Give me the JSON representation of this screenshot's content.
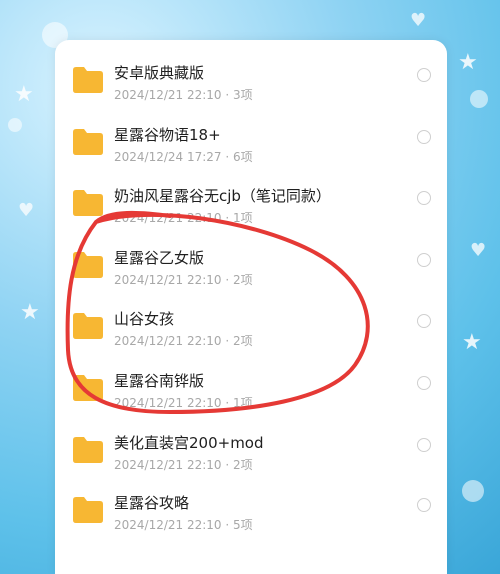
{
  "files": [
    {
      "name": "安卓版典藏版",
      "meta": "2024/12/21 22:10 · 3项"
    },
    {
      "name": "星露谷物语18+",
      "meta": "2024/12/24 17:27 · 6项"
    },
    {
      "name": "奶油风星露谷无cjb（笔记同款）",
      "meta": "2024/12/21 22:10 · 1项"
    },
    {
      "name": "星露谷乙女版",
      "meta": "2024/12/21 22:10 · 2项"
    },
    {
      "name": "山谷女孩",
      "meta": "2024/12/21 22:10 · 2项"
    },
    {
      "name": "星露谷南铧版",
      "meta": "2024/12/21 22:10 · 1项"
    },
    {
      "name": "美化直装宫200+mod",
      "meta": "2024/12/21 22:10 · 2项"
    },
    {
      "name": "星露谷攻略",
      "meta": "2024/12/21 22:10 · 5项"
    }
  ],
  "icons": {
    "folder": "folder-icon",
    "select": "radio-circle"
  },
  "colors": {
    "folder": "#F7B733",
    "annotation": "#E53935",
    "background": "#5EC1EA"
  }
}
